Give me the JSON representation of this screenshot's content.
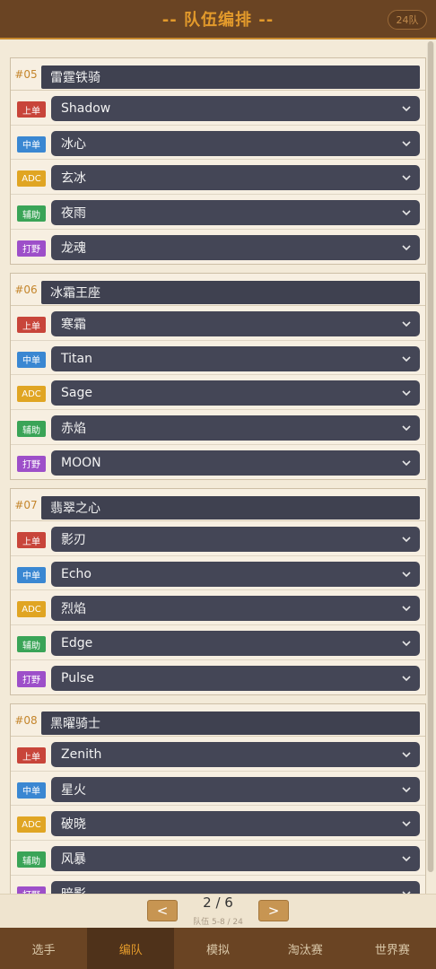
{
  "header": {
    "title": "-- 队伍编排 --",
    "badge": "24队"
  },
  "teams": [
    {
      "num": "#05",
      "name": "雷霆铁骑",
      "slots": [
        {
          "role": "上单",
          "role_key": "top",
          "player": "Shadow"
        },
        {
          "role": "中单",
          "role_key": "mid",
          "player": "冰心"
        },
        {
          "role": "ADC",
          "role_key": "adc",
          "player": "玄冰"
        },
        {
          "role": "辅助",
          "role_key": "sup",
          "player": "夜雨"
        },
        {
          "role": "打野",
          "role_key": "jg",
          "player": "龙魂"
        }
      ]
    },
    {
      "num": "#06",
      "name": "冰霜王座",
      "slots": [
        {
          "role": "上单",
          "role_key": "top",
          "player": "寒霜"
        },
        {
          "role": "中单",
          "role_key": "mid",
          "player": "Titan"
        },
        {
          "role": "ADC",
          "role_key": "adc",
          "player": "Sage"
        },
        {
          "role": "辅助",
          "role_key": "sup",
          "player": "赤焰"
        },
        {
          "role": "打野",
          "role_key": "jg",
          "player": "MOON"
        }
      ]
    },
    {
      "num": "#07",
      "name": "翡翠之心",
      "slots": [
        {
          "role": "上单",
          "role_key": "top",
          "player": "影刃"
        },
        {
          "role": "中单",
          "role_key": "mid",
          "player": "Echo"
        },
        {
          "role": "ADC",
          "role_key": "adc",
          "player": "烈焰"
        },
        {
          "role": "辅助",
          "role_key": "sup",
          "player": "Edge"
        },
        {
          "role": "打野",
          "role_key": "jg",
          "player": "Pulse"
        }
      ]
    },
    {
      "num": "#08",
      "name": "黑曜骑士",
      "slots": [
        {
          "role": "上单",
          "role_key": "top",
          "player": "Zenith"
        },
        {
          "role": "中单",
          "role_key": "mid",
          "player": "星火"
        },
        {
          "role": "ADC",
          "role_key": "adc",
          "player": "破晓"
        },
        {
          "role": "辅助",
          "role_key": "sup",
          "player": "风暴"
        },
        {
          "role": "打野",
          "role_key": "jg",
          "player": "暗影"
        }
      ]
    }
  ],
  "pager": {
    "prev": "<",
    "next": ">",
    "page": "2 / 6",
    "range": "队伍 5-8 / 24"
  },
  "nav": {
    "items": [
      {
        "label": "选手"
      },
      {
        "label": "编队"
      },
      {
        "label": "模拟"
      },
      {
        "label": "淘汰赛"
      },
      {
        "label": "世界赛"
      }
    ],
    "active_index": 1
  },
  "colors": {
    "header_bg": "#6a4423",
    "accent": "#e39a2b",
    "select_bg": "#444656",
    "role_top": "#c8453a",
    "role_mid": "#3a87d2",
    "role_adc": "#e0a523",
    "role_sup": "#3aa457",
    "role_jg": "#9d4fc9"
  },
  "icons": {
    "dropdown": "chevron-down-icon"
  }
}
